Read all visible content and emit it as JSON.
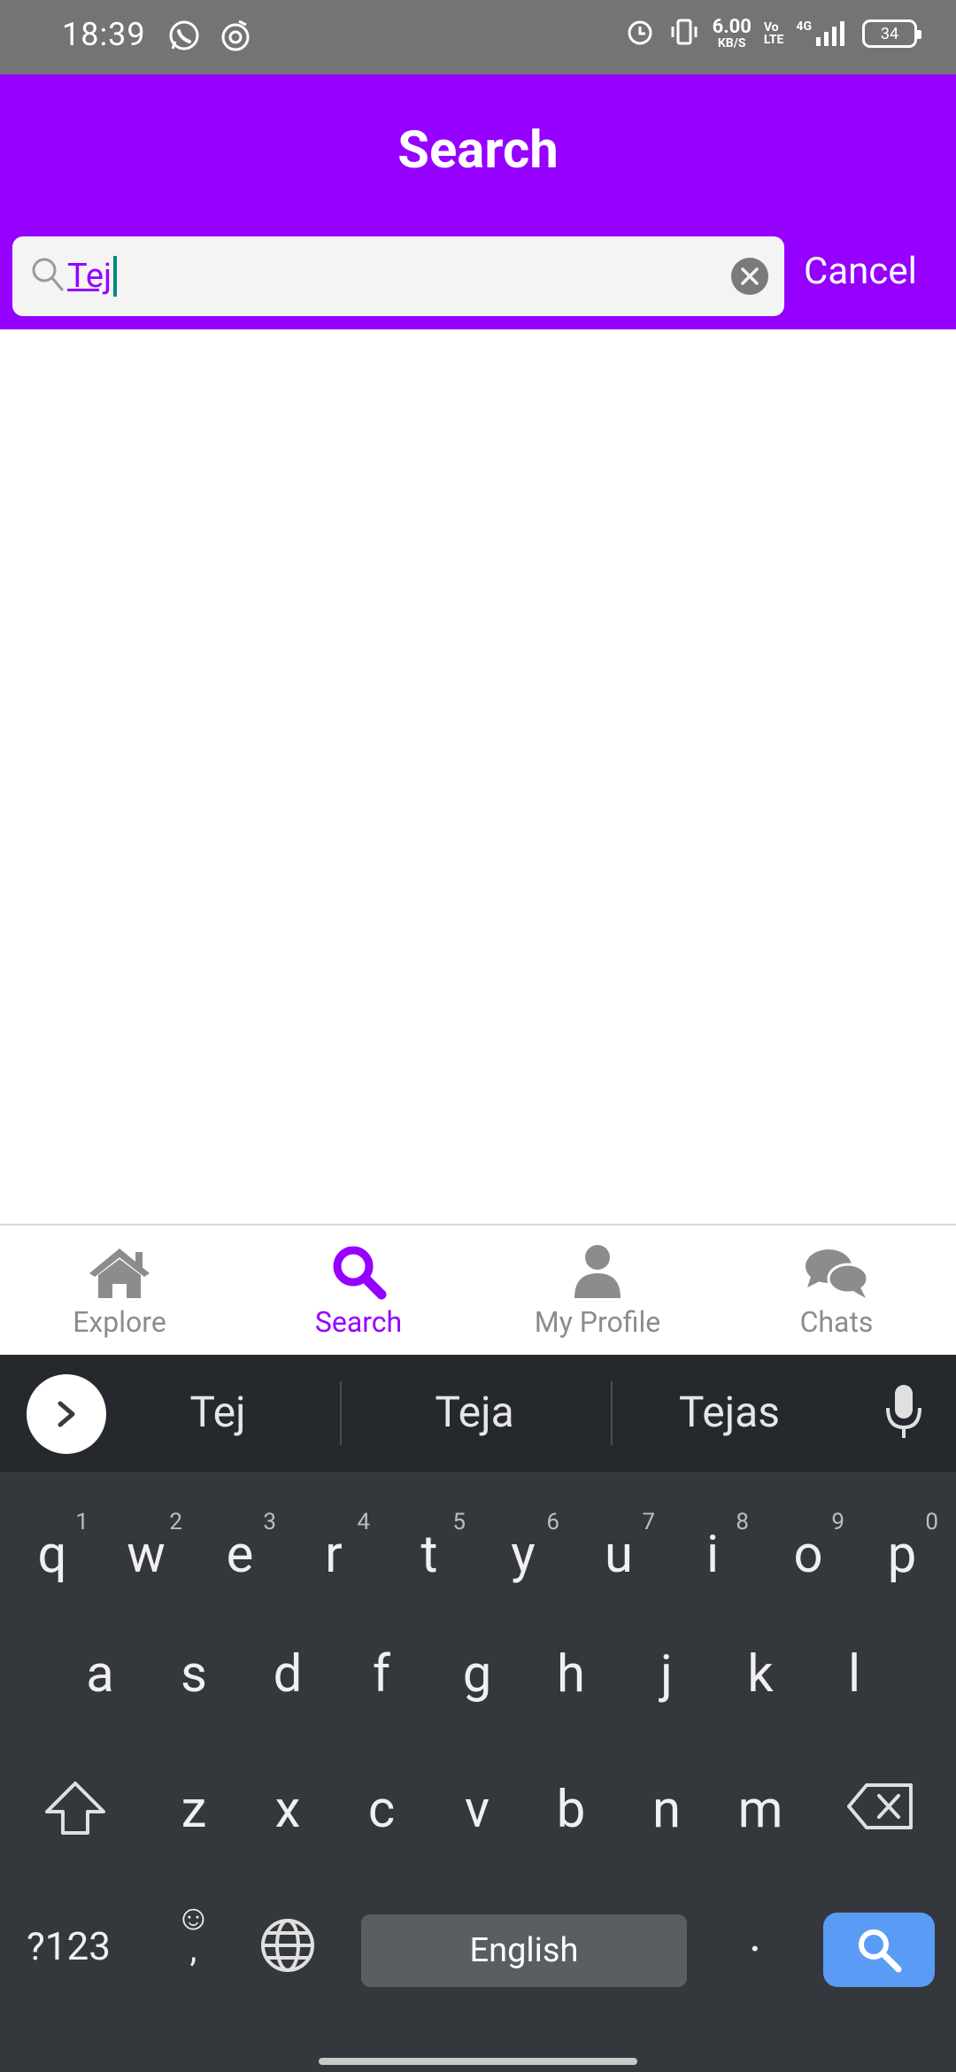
{
  "status_bar": {
    "time": "18:39",
    "net_speed_value": "6.00",
    "net_speed_unit": "KB/S",
    "volte_top": "Vo",
    "volte_bottom": "LTE",
    "network": "4G",
    "battery": "34",
    "icons": [
      "whatsapp-icon",
      "music-icon",
      "alarm-icon",
      "vibrate-icon",
      "signal-icon",
      "battery-icon"
    ]
  },
  "header": {
    "title": "Search"
  },
  "search": {
    "value": "Tej",
    "cancel_label": "Cancel"
  },
  "tabs": [
    {
      "label": "Explore",
      "icon": "home-icon",
      "active": false
    },
    {
      "label": "Search",
      "icon": "search-icon",
      "active": true
    },
    {
      "label": "My Profile",
      "icon": "person-icon",
      "active": false
    },
    {
      "label": "Chats",
      "icon": "chat-icon",
      "active": false
    }
  ],
  "keyboard": {
    "suggestions": [
      "Tej",
      "Teja",
      "Tejas"
    ],
    "row1": [
      {
        "k": "q",
        "n": "1"
      },
      {
        "k": "w",
        "n": "2"
      },
      {
        "k": "e",
        "n": "3"
      },
      {
        "k": "r",
        "n": "4"
      },
      {
        "k": "t",
        "n": "5"
      },
      {
        "k": "y",
        "n": "6"
      },
      {
        "k": "u",
        "n": "7"
      },
      {
        "k": "i",
        "n": "8"
      },
      {
        "k": "o",
        "n": "9"
      },
      {
        "k": "p",
        "n": "0"
      }
    ],
    "row2": [
      "a",
      "s",
      "d",
      "f",
      "g",
      "h",
      "j",
      "k",
      "l"
    ],
    "row3": [
      "z",
      "x",
      "c",
      "v",
      "b",
      "n",
      "m"
    ],
    "symbols_label": "?123",
    "emoji_label": "☺",
    "comma_label": ",",
    "space_label": "English",
    "period_label": "."
  },
  "colors": {
    "brand": "#9500ff",
    "inactive_tab": "#8c8c8c",
    "keyboard_bg": "#34383c",
    "search_key": "#5a9cf5"
  }
}
